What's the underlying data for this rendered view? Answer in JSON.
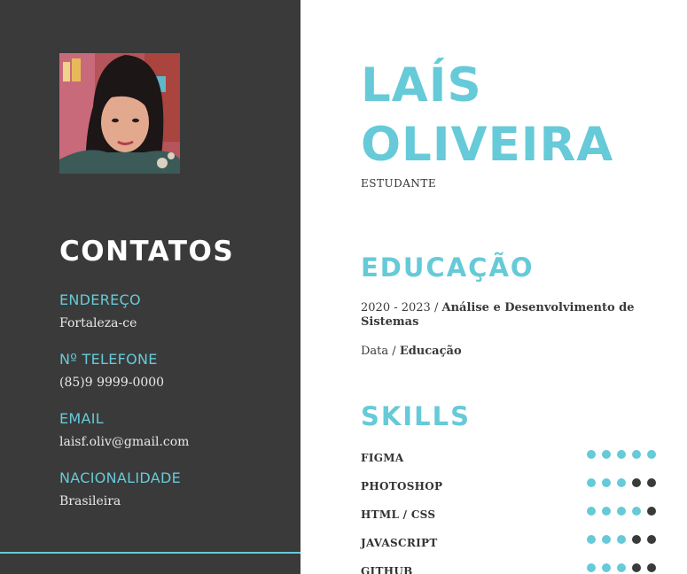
{
  "name": {
    "line1": "LAÍS",
    "line2": "OLIVEIRA"
  },
  "role": "ESTUDANTE",
  "contacts": {
    "title": "CONTATOS",
    "address_label": "ENDEREÇO",
    "address_value": "Fortaleza-ce",
    "phone_label": "Nº TELEFONE",
    "phone_value": "(85)9 9999-0000",
    "email_label": "EMAIL",
    "email_value": "laisf.oliv@gmail.com",
    "nationality_label": "NACIONALIDADE",
    "nationality_value": "Brasileira"
  },
  "education": {
    "title": "EDUCAÇÃO",
    "items": [
      {
        "date": "2020 - 2023",
        "separator": " / ",
        "course": "Análise e Desenvolvimento de Sistemas"
      },
      {
        "date": "Data",
        "separator": " / ",
        "course": "Educação"
      }
    ]
  },
  "skills": {
    "title": "SKILLS",
    "max_level": 5,
    "items": [
      {
        "name": "FIGMA",
        "level": 5
      },
      {
        "name": "PHOTOSHOP",
        "level": 3
      },
      {
        "name": "HTML / CSS",
        "level": 4
      },
      {
        "name": "JAVASCRIPT",
        "level": 3
      },
      {
        "name": "GITHUB",
        "level": 3
      }
    ]
  },
  "colors": {
    "accent": "#66cad8",
    "sidebar": "#3a3a3a",
    "dot_off": "#3a3a3a"
  }
}
